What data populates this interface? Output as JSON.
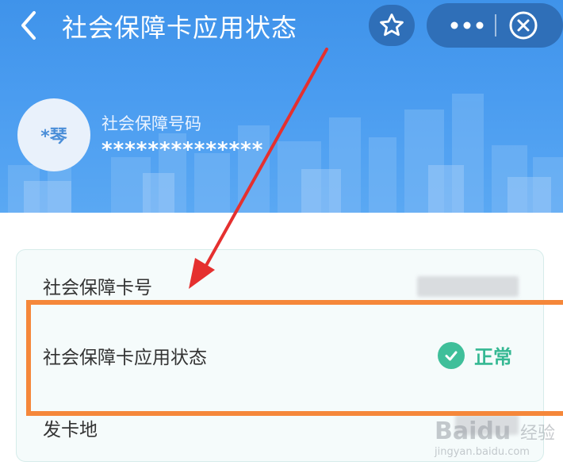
{
  "nav": {
    "title": "社会保障卡应用状态",
    "icons": {
      "back": "chevron-left-icon",
      "favorite": "star-icon",
      "more": "more-icon",
      "close": "close-circle-icon"
    }
  },
  "profile": {
    "avatar_text": "*琴",
    "label": "社会保障号码",
    "value": "**************"
  },
  "info_card": {
    "rows": [
      {
        "label": "社会保障卡号"
      },
      {
        "label": "社会保障卡应用状态",
        "status": "正常"
      },
      {
        "label": "发卡地"
      }
    ]
  },
  "watermark": {
    "logo": "Baidu",
    "text": "经验",
    "url": "jingyan.baidu.com"
  },
  "colors": {
    "header": "#4a9cf0",
    "accent_orange": "#f5873a",
    "status_green": "#3fbf9a",
    "arrow_red": "#e5302f"
  }
}
